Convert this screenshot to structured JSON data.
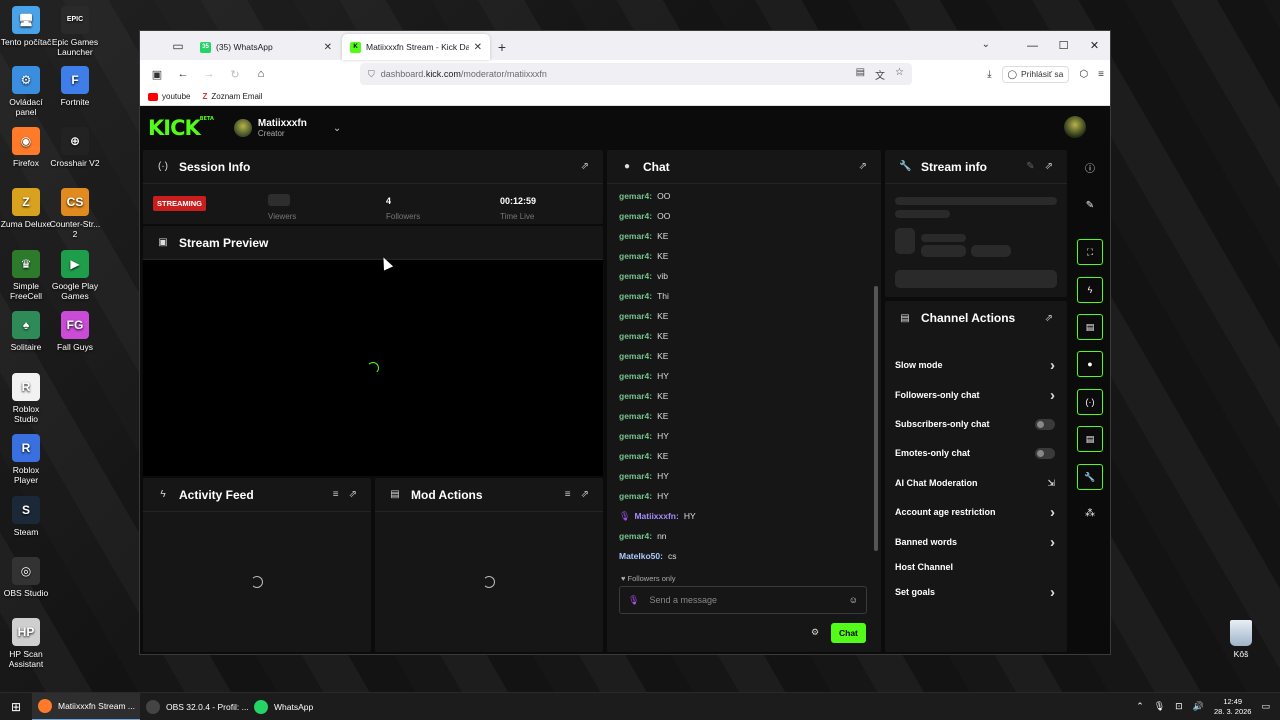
{
  "desktop": {
    "icons": [
      {
        "label": "Tento počítač",
        "icon": "computer-icon",
        "color": "#4aa3e8"
      },
      {
        "label": "Epic Games Launcher",
        "icon": "epic-games-icon",
        "color": "#2a2a2a"
      },
      {
        "label": "Ovládací panel",
        "icon": "control-panel-icon",
        "color": "#3a8ee0"
      },
      {
        "label": "Fortnite",
        "icon": "fortnite-icon",
        "color": "#3f7ee8"
      },
      {
        "label": "Firefox",
        "icon": "firefox-icon",
        "color": "#ff7b2a"
      },
      {
        "label": "Crosshair V2",
        "icon": "crosshair-icon",
        "color": "#222"
      },
      {
        "label": "Zuma Deluxe",
        "icon": "zuma-icon",
        "color": "#d9a21e"
      },
      {
        "label": "Counter-Str... 2",
        "icon": "counter-strike-icon",
        "color": "#e08a1f"
      },
      {
        "label": "Simple FreeCell",
        "icon": "freecell-icon",
        "color": "#2d7a2d"
      },
      {
        "label": "Google Play Games",
        "icon": "google-play-games-icon",
        "color": "#1e9e4a"
      },
      {
        "label": "Solitaire",
        "icon": "solitaire-icon",
        "color": "#2e8b57"
      },
      {
        "label": "Fall Guys",
        "icon": "fall-guys-icon",
        "color": "#c94bd6"
      },
      {
        "label": "Roblox Studio",
        "icon": "roblox-studio-icon",
        "color": "#f2f2f2"
      },
      {
        "label": "Roblox Player",
        "icon": "roblox-player-icon",
        "color": "#3a6fe0"
      },
      {
        "label": "Steam",
        "icon": "steam-icon",
        "color": "#1b2838"
      },
      {
        "label": "OBS Studio",
        "icon": "obs-icon",
        "color": "#333"
      },
      {
        "label": "HP Scan Assistant",
        "icon": "hp-scan-icon",
        "color": "#cfcfcf"
      }
    ],
    "recycle_bin": "Kôš"
  },
  "browser": {
    "tabs": [
      {
        "title": "(35) WhatsApp",
        "favicon": "whatsapp-icon",
        "badge": "35",
        "color": "#25d366",
        "active": false
      },
      {
        "title": "Matiixxxfn Stream - Kick Dashbo",
        "favicon": "kick-icon",
        "badge": "K",
        "color": "#53fc18",
        "active": true
      }
    ],
    "url_prefix": "dashboard.",
    "url_host": "kick.com",
    "url_path": "/moderator/matiixxxfn",
    "signin_label": "Prihlásiť sa",
    "bookmarks": [
      {
        "label": "youtube",
        "color": "#ff0000"
      },
      {
        "label": "Zoznam Email",
        "color": "#e0332b"
      }
    ]
  },
  "kick": {
    "logo": "KICK",
    "logo_tag": "BETA",
    "channel_name": "Matiixxxfn",
    "channel_role": "Creator",
    "accent": "#53fc18",
    "session": {
      "title": "Session Info",
      "status": "STREAMING",
      "viewers_label": "Viewers",
      "followers_value": "4",
      "followers_label": "Followers",
      "time_value": "00:12:59",
      "time_label": "Time Live"
    },
    "preview": {
      "title": "Stream Preview"
    },
    "activity": {
      "title": "Activity Feed"
    },
    "mod_actions": {
      "title": "Mod Actions"
    },
    "chat": {
      "title": "Chat",
      "messages": [
        {
          "user": "gemar4:",
          "text": "OO",
          "style": "green"
        },
        {
          "user": "gemar4:",
          "text": "OO",
          "style": "green"
        },
        {
          "user": "gemar4:",
          "text": "KE",
          "style": "green"
        },
        {
          "user": "gemar4:",
          "text": "KE",
          "style": "green"
        },
        {
          "user": "gemar4:",
          "text": "vib",
          "style": "green"
        },
        {
          "user": "gemar4:",
          "text": "Thi",
          "style": "green"
        },
        {
          "user": "gemar4:",
          "text": "KE",
          "style": "green"
        },
        {
          "user": "gemar4:",
          "text": "KE",
          "style": "green"
        },
        {
          "user": "gemar4:",
          "text": "KE",
          "style": "green"
        },
        {
          "user": "gemar4:",
          "text": "HY",
          "style": "green"
        },
        {
          "user": "gemar4:",
          "text": "KE",
          "style": "green"
        },
        {
          "user": "gemar4:",
          "text": "KE",
          "style": "green"
        },
        {
          "user": "gemar4:",
          "text": "HY",
          "style": "green"
        },
        {
          "user": "gemar4:",
          "text": "KE",
          "style": "green"
        },
        {
          "user": "gemar4:",
          "text": "HY",
          "style": "green"
        },
        {
          "user": "gemar4:",
          "text": "HY",
          "style": "green"
        },
        {
          "user": "Matiixxxfn:",
          "text": "HY",
          "style": "purple"
        },
        {
          "user": "gemar4:",
          "text": "nn",
          "style": "green"
        },
        {
          "user": "Matelko50:",
          "text": "cs",
          "style": "blue"
        }
      ],
      "followers_only": "Followers only",
      "placeholder": "Send a message",
      "send_label": "Chat"
    },
    "stream_info": {
      "title": "Stream info"
    },
    "channel_actions": {
      "title": "Channel Actions",
      "items": [
        {
          "label": "Slow mode",
          "control": "chevron"
        },
        {
          "label": "Followers-only chat",
          "control": "chevron"
        },
        {
          "label": "Subscribers-only chat",
          "control": "toggle"
        },
        {
          "label": "Emotes-only chat",
          "control": "toggle"
        },
        {
          "label": "AI Chat Moderation",
          "control": "external"
        },
        {
          "label": "Account age restriction",
          "control": "chevron"
        },
        {
          "label": "Banned words",
          "control": "chevron"
        },
        {
          "label": "Host Channel",
          "control": "none"
        },
        {
          "label": "Set goals",
          "control": "chevron"
        }
      ]
    }
  },
  "taskbar": {
    "items": [
      {
        "label": "Matiixxxfn Stream ...",
        "icon": "firefox-icon",
        "color": "#ff7b2a",
        "active": true
      },
      {
        "label": "OBS 32.0.4 - Profil: ...",
        "icon": "obs-icon",
        "color": "#444",
        "active": false
      },
      {
        "label": "WhatsApp",
        "icon": "whatsapp-icon",
        "color": "#25d366",
        "active": false
      }
    ],
    "time": "12:49",
    "date": "28. 3. 2026"
  }
}
